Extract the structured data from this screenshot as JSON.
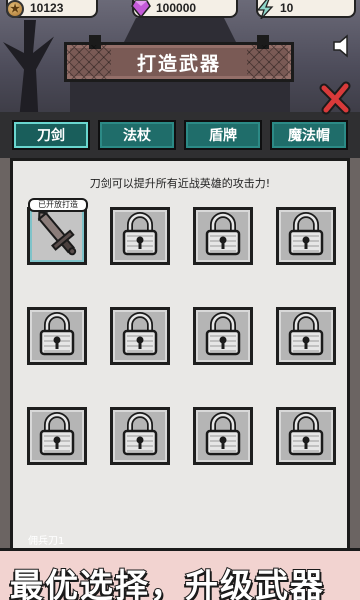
{
  "resources": {
    "coins": "10123",
    "gems": "100000",
    "energy": "10"
  },
  "title": "打造武器",
  "tabs": [
    {
      "label": "刀剑",
      "active": true
    },
    {
      "label": "法杖",
      "active": false
    },
    {
      "label": "盾牌",
      "active": false
    },
    {
      "label": "魔法帽",
      "active": false
    }
  ],
  "hint": "刀剑可以提升所有近战英雄的攻击力!",
  "badge": "已开放打造",
  "slots": [
    {
      "state": "unlocked",
      "icon": "sword-icon"
    },
    {
      "state": "locked",
      "icon": "lock-icon"
    },
    {
      "state": "locked",
      "icon": "lock-icon"
    },
    {
      "state": "locked",
      "icon": "lock-icon"
    },
    {
      "state": "locked",
      "icon": "lock-icon"
    },
    {
      "state": "locked",
      "icon": "lock-icon"
    },
    {
      "state": "locked",
      "icon": "lock-icon"
    },
    {
      "state": "locked",
      "icon": "lock-icon"
    },
    {
      "state": "locked",
      "icon": "lock-icon"
    },
    {
      "state": "locked",
      "icon": "lock-icon"
    },
    {
      "state": "locked",
      "icon": "lock-icon"
    },
    {
      "state": "locked",
      "icon": "lock-icon"
    }
  ],
  "selected_weapon": "佣兵刀1",
  "slogan": "最优选择，升级武器",
  "colors": {
    "tab": "#1f6d6a",
    "banner": "#7a5a55",
    "slogan_bg": "#f2d3d0",
    "close": "#d93a3a"
  }
}
